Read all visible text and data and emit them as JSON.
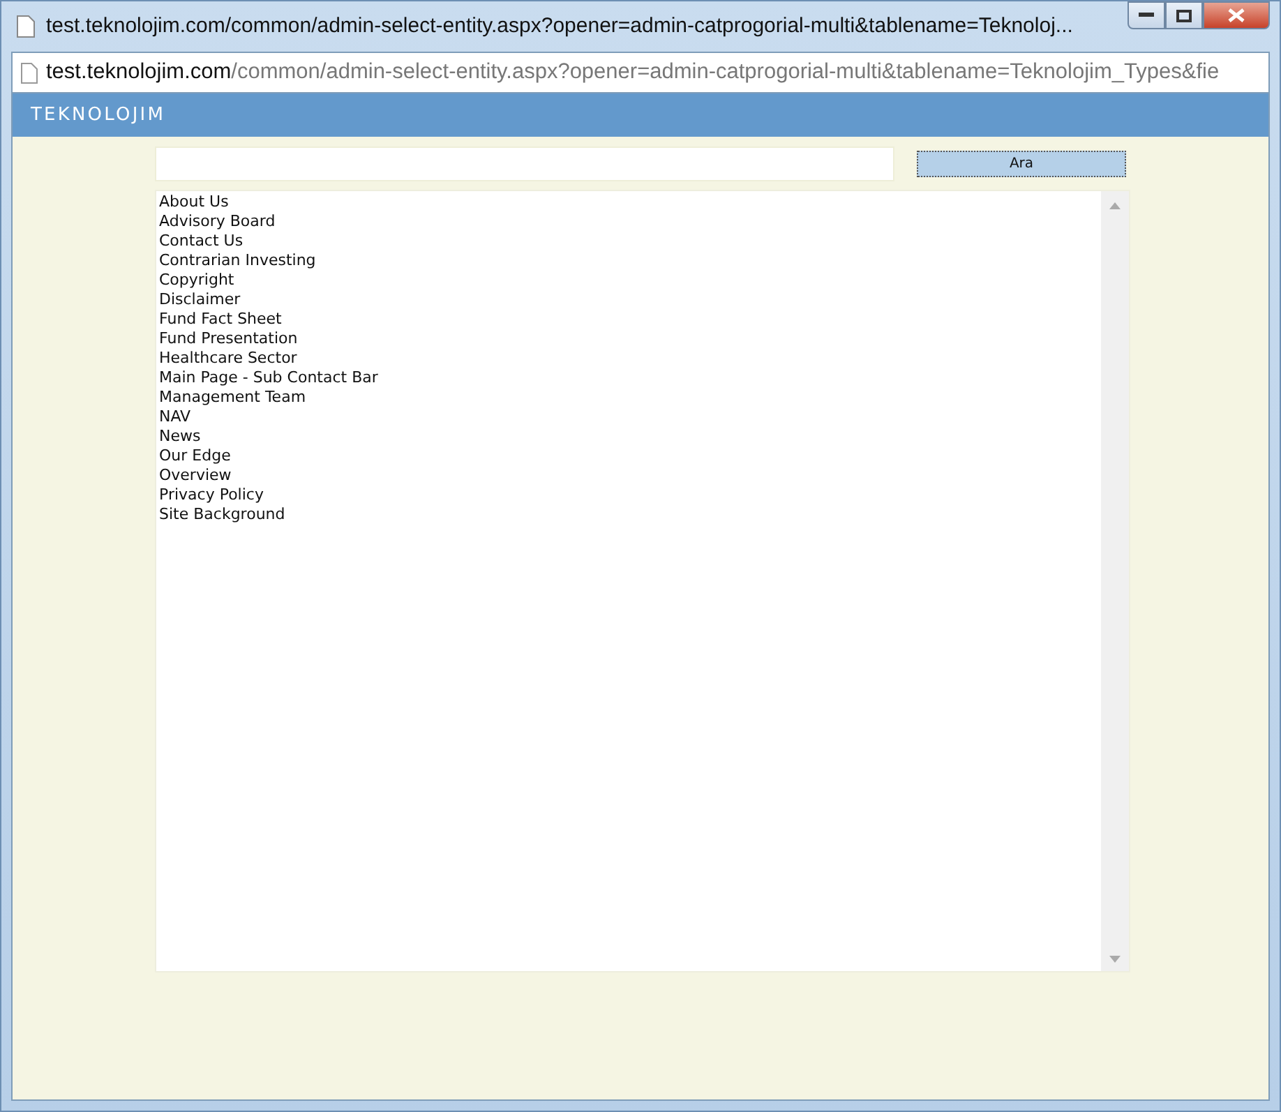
{
  "window": {
    "title": "test.teknolojim.com/common/admin-select-entity.aspx?opener=admin-catprogorial-multi&tablename=Teknoloj..."
  },
  "address_bar": {
    "host": "test.teknolojim.com",
    "path": "/common/admin-select-entity.aspx?opener=admin-catprogorial-multi&tablename=Teknolojim_Types&fie"
  },
  "header": {
    "logo": "TEKNOLOJIM"
  },
  "search": {
    "button": "Ara"
  },
  "list": {
    "items": [
      {
        "label": "About Us",
        "selected": false
      },
      {
        "label": "Advisory Board",
        "selected": false
      },
      {
        "label": "Contact Us",
        "selected": false
      },
      {
        "label": "Contrarian Investing",
        "selected": false
      },
      {
        "label": "Copyright",
        "selected": false
      },
      {
        "label": "Disclaimer",
        "selected": false
      },
      {
        "label": "Fund Fact Sheet",
        "selected": false
      },
      {
        "label": "Fund Presentation",
        "selected": false
      },
      {
        "label": "Healthcare Sector",
        "selected": false
      },
      {
        "label": "Main Page - Sub Contact Bar",
        "selected": false
      },
      {
        "label": "Management Team",
        "selected": false
      },
      {
        "label": "NAV",
        "selected": false
      },
      {
        "label": "News",
        "selected": false
      },
      {
        "label": "Our Edge",
        "selected": false
      },
      {
        "label": "Overview",
        "selected": false
      },
      {
        "label": "Privacy Policy",
        "selected": false
      },
      {
        "label": "Site Background",
        "selected": false
      }
    ]
  }
}
